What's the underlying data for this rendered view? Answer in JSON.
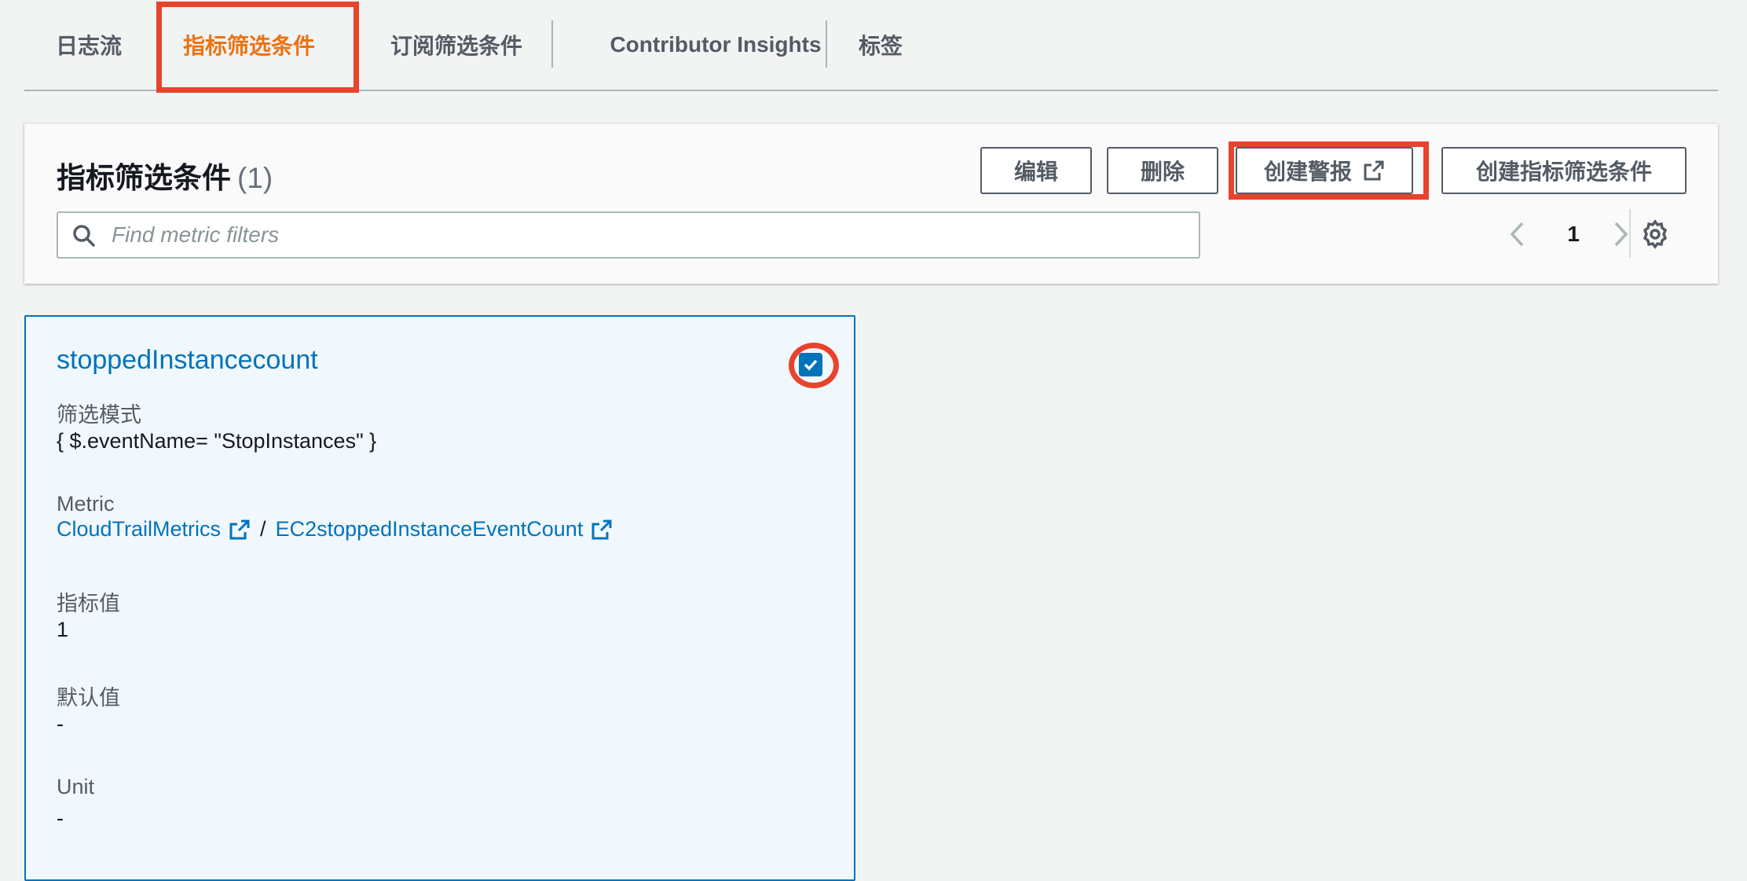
{
  "tabs": [
    {
      "label": "日志流",
      "active": false
    },
    {
      "label": "指标筛选条件",
      "active": true
    },
    {
      "label": "订阅筛选条件",
      "active": false
    },
    {
      "label": "Contributor Insights",
      "active": false
    },
    {
      "label": "标签",
      "active": false
    }
  ],
  "panel": {
    "title": "指标筛选条件",
    "count": "(1)",
    "buttons": {
      "edit": "编辑",
      "delete": "删除",
      "create_alarm": "创建警报",
      "create_filter": "创建指标筛选条件"
    },
    "search": {
      "placeholder": "Find metric filters",
      "value": ""
    },
    "pagination": {
      "current_page": "1"
    }
  },
  "card": {
    "name": "stoppedInstancecount",
    "selected": true,
    "filter_pattern_label": "筛选模式",
    "filter_pattern_value": "{ $.eventName= \"StopInstances\" }",
    "metric_label": "Metric",
    "metric_namespace": "CloudTrailMetrics",
    "metric_separator": "/",
    "metric_name": "EC2stoppedInstanceEventCount",
    "metric_value_label": "指标值",
    "metric_value": "1",
    "default_value_label": "默认值",
    "default_value": "-",
    "unit_label": "Unit",
    "unit_value": "-"
  },
  "colors": {
    "accent_orange": "#ec7211",
    "link_blue": "#0073bb",
    "highlight_red": "#e8432d",
    "page_bg": "#f2f3f3"
  },
  "icons": [
    "search-icon",
    "external-link-icon",
    "chevron-left-icon",
    "chevron-right-icon",
    "gear-icon",
    "checkbox-checked-icon"
  ]
}
